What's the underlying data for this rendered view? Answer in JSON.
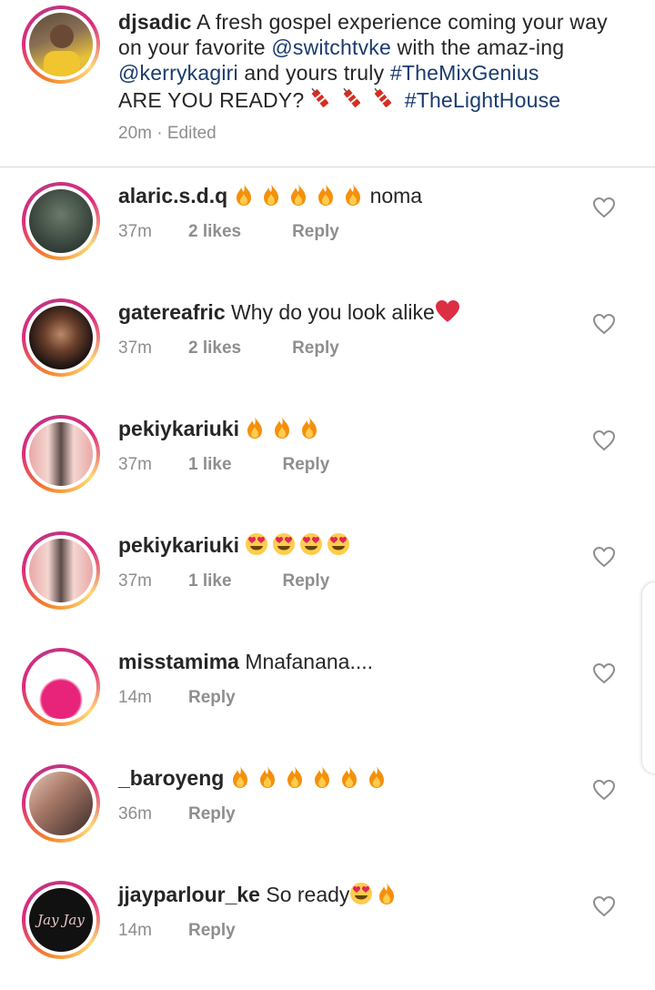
{
  "post": {
    "author": "djsadic",
    "caption_part1": "A fresh gospel experience coming your way on your favorite ",
    "mention1": "@switchtvke",
    "caption_part2": " with the amaz-ing ",
    "mention2": "@kerrykagiri",
    "caption_part3": " and yours truly ",
    "hashtag1": "#TheMixGenius",
    "caption_part4": "ARE YOU READY? ",
    "hashtag2": "#TheLightHouse",
    "time": "20m",
    "edited": "Edited"
  },
  "comments": [
    {
      "user": "alaric.s.d.q",
      "text": "noma",
      "emojis": [
        "fire",
        "fire",
        "fire",
        "fire",
        "fire"
      ],
      "emoji_before_text": true,
      "time": "37m",
      "likes": "2 likes",
      "reply": "Reply"
    },
    {
      "user": "gatereafric",
      "text": "Why do you look alike",
      "emojis": [
        "red-heart"
      ],
      "emoji_before_text": false,
      "time": "37m",
      "likes": "2 likes",
      "reply": "Reply"
    },
    {
      "user": "pekiykariuki",
      "text": "",
      "emojis": [
        "fire",
        "fire",
        "fire"
      ],
      "emoji_before_text": false,
      "time": "37m",
      "likes": "1 like",
      "reply": "Reply"
    },
    {
      "user": "pekiykariuki",
      "text": "",
      "emojis": [
        "heart-eyes",
        "heart-eyes",
        "heart-eyes",
        "heart-eyes"
      ],
      "emoji_before_text": false,
      "time": "37m",
      "likes": "1 like",
      "reply": "Reply"
    },
    {
      "user": "misstamima",
      "text": "Mnafanana....",
      "emojis": [],
      "emoji_before_text": false,
      "time": "14m",
      "likes": "",
      "reply": "Reply"
    },
    {
      "user": "_baroyeng",
      "text": "",
      "emojis": [
        "fire",
        "fire",
        "fire",
        "fire",
        "fire",
        "fire"
      ],
      "emoji_before_text": false,
      "time": "36m",
      "likes": "",
      "reply": "Reply"
    },
    {
      "user": "jjayparlour_ke",
      "text": "So ready",
      "emojis": [
        "heart-eyes",
        "fire"
      ],
      "emoji_before_text": false,
      "time": "14m",
      "likes": "",
      "reply": "Reply"
    }
  ],
  "avatar_logo_text": "Jay Jay",
  "colors": {
    "text": "#262626",
    "muted": "#8e8e8e",
    "link": "#1a3b6e",
    "divider": "#dbdbdb"
  }
}
